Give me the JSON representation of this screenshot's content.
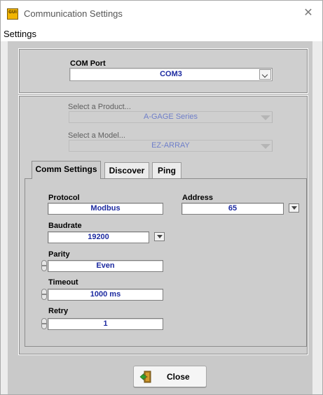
{
  "window": {
    "title": "Communication Settings",
    "app_icon_text": "GUI"
  },
  "menu": {
    "settings": "Settings"
  },
  "com_port": {
    "label": "COM Port",
    "value": "COM3"
  },
  "product": {
    "label": "Select a Product...",
    "value": "A-GAGE Series"
  },
  "model": {
    "label": "Select a Model...",
    "value": "EZ-ARRAY"
  },
  "tabs": [
    {
      "label": "Comm Settings",
      "active": true
    },
    {
      "label": "Discover",
      "active": false
    },
    {
      "label": "Ping",
      "active": false
    }
  ],
  "comm": {
    "protocol": {
      "label": "Protocol",
      "value": "Modbus"
    },
    "address": {
      "label": "Address",
      "value": "65"
    },
    "baudrate": {
      "label": "Baudrate",
      "value": "19200"
    },
    "parity": {
      "label": "Parity",
      "value": "Even"
    },
    "timeout": {
      "label": "Timeout",
      "value": "1000 ms"
    },
    "retry": {
      "label": "Retry",
      "value": "1"
    }
  },
  "footer": {
    "close_label": "Close"
  },
  "icons": [
    "app-icon",
    "close-window-icon",
    "dropdown-arrow-icon",
    "spinner-icon",
    "exit-door-icon"
  ],
  "colors": {
    "value_text": "#1c2aa0",
    "disabled_value_text": "#6f7fc9",
    "panel_bg": "#cfcfcf"
  }
}
